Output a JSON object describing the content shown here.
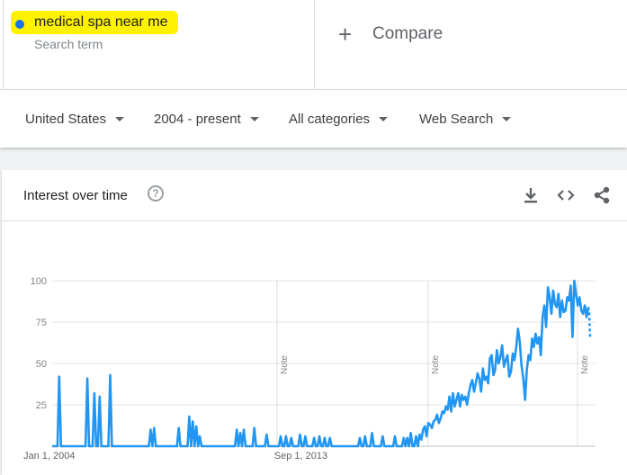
{
  "search": {
    "term": "medical spa near me",
    "term_sub": "Search term",
    "term_color": "#1a73e8",
    "highlight_color": "#fff200"
  },
  "compare": {
    "label": "Compare"
  },
  "filters": [
    {
      "label": "United States"
    },
    {
      "label": "2004 - present"
    },
    {
      "label": "All categories"
    },
    {
      "label": "Web Search"
    }
  ],
  "card": {
    "title": "Interest over time",
    "actions": [
      "download-icon",
      "embed-icon",
      "share-icon"
    ]
  },
  "chart_data": {
    "type": "line",
    "title": "Interest over time",
    "xlabel": "",
    "ylabel": "",
    "ylim": [
      0,
      100
    ],
    "yticks": [
      25,
      50,
      75,
      100
    ],
    "x_tick_labels": [
      "Jan 1, 2004",
      "Sep 1, 2013"
    ],
    "notes": [
      "Note",
      "Note",
      "Note"
    ],
    "color": "#2196f3",
    "series": [
      {
        "values": [
          0,
          0,
          0,
          0,
          42,
          0,
          0,
          0,
          0,
          0,
          0,
          0,
          0,
          0,
          0,
          0,
          0,
          0,
          0,
          0,
          41,
          0,
          0,
          0,
          32,
          0,
          0,
          30,
          0,
          0,
          0,
          0,
          0,
          43,
          0,
          0,
          0,
          0,
          0,
          0,
          0,
          0,
          0,
          0,
          0,
          0,
          0,
          0,
          0,
          0,
          0,
          0,
          0,
          0,
          0,
          0,
          10,
          0,
          11,
          0,
          0,
          0,
          0,
          0,
          0,
          0,
          0,
          0,
          0,
          0,
          0,
          0,
          11,
          0,
          0,
          0,
          0,
          0,
          18,
          0,
          15,
          0,
          12,
          0,
          6,
          0,
          0,
          0,
          0,
          0,
          0,
          0,
          0,
          0,
          0,
          0,
          0,
          0,
          0,
          0,
          0,
          0,
          0,
          0,
          0,
          10,
          0,
          8,
          0,
          10,
          0,
          0,
          0,
          0,
          0,
          11,
          0,
          0,
          0,
          0,
          0,
          0,
          7,
          0,
          0,
          0,
          0,
          0,
          0,
          0,
          6,
          0,
          0,
          6,
          0,
          0,
          5,
          0,
          0,
          0,
          0,
          7,
          0,
          0,
          6,
          0,
          0,
          0,
          0,
          5,
          0,
          0,
          6,
          0,
          0,
          5,
          0,
          0,
          5,
          0,
          0,
          0,
          0,
          0,
          0,
          0,
          0,
          0,
          0,
          0,
          0,
          0,
          0,
          0,
          0,
          5,
          0,
          0,
          6,
          0,
          0,
          0,
          8,
          0,
          0,
          0,
          0,
          0,
          6,
          0,
          0,
          0,
          0,
          0,
          0,
          6,
          0,
          0,
          0,
          0,
          5,
          0,
          5,
          0,
          8,
          0,
          0,
          6,
          0,
          7,
          4,
          10,
          12,
          6,
          14,
          13,
          11,
          15,
          16,
          19,
          14,
          17,
          21,
          20,
          24,
          22,
          30,
          21,
          32,
          24,
          28,
          32,
          24,
          31,
          28,
          30,
          25,
          32,
          37,
          40,
          33,
          38,
          44,
          41,
          33,
          47,
          40,
          42,
          38,
          53,
          55,
          43,
          46,
          58,
          50,
          54,
          61,
          48,
          52,
          55,
          42,
          45,
          56,
          52,
          60,
          71,
          63,
          49,
          41,
          28,
          46,
          55,
          52,
          65,
          60,
          68,
          62,
          66,
          55,
          78,
          85,
          72,
          96,
          90,
          80,
          94,
          86,
          84,
          92,
          78,
          88,
          81,
          82,
          90,
          88,
          97,
          66,
          100,
          92,
          85,
          90,
          82,
          80,
          85,
          78,
          84
        ]
      }
    ],
    "partial_tail": [
      80,
      72,
      66
    ]
  }
}
